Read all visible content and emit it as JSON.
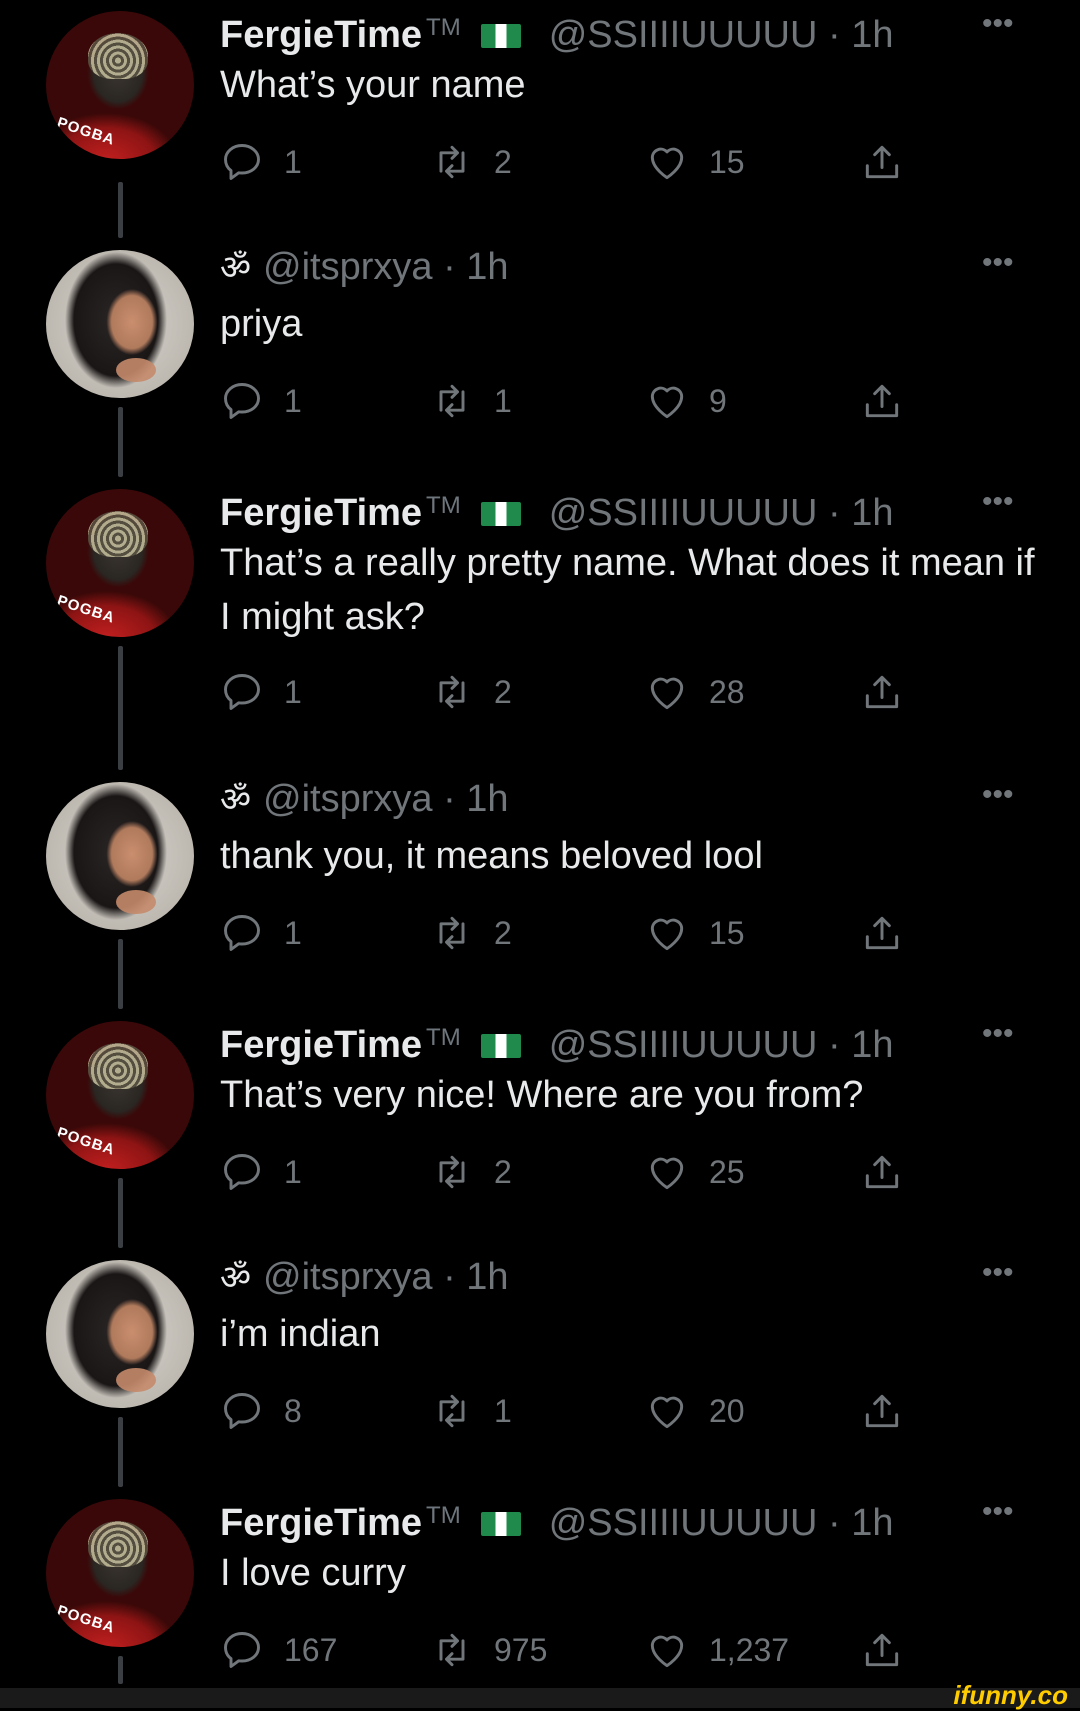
{
  "tweets": [
    {
      "author_type": "fergie",
      "name": "FergieTime",
      "tm": "TM",
      "handle": "@SSIIIIUUUUU",
      "time": "· 1h",
      "text": "What’s your name",
      "replies": "1",
      "retweets": "2",
      "likes": "15"
    },
    {
      "author_type": "priya",
      "om": "ॐ",
      "handle": "@itsprxya",
      "time": "· 1h",
      "text": "priya",
      "replies": "1",
      "retweets": "1",
      "likes": "9"
    },
    {
      "author_type": "fergie",
      "name": "FergieTime",
      "tm": "TM",
      "handle": "@SSIIIIUUUUU",
      "time": "· 1h",
      "text": "That’s a really pretty name. What does it mean if I might ask?",
      "replies": "1",
      "retweets": "2",
      "likes": "28"
    },
    {
      "author_type": "priya",
      "om": "ॐ",
      "handle": "@itsprxya",
      "time": "· 1h",
      "text": "thank you, it means beloved lool",
      "replies": "1",
      "retweets": "2",
      "likes": "15"
    },
    {
      "author_type": "fergie",
      "name": "FergieTime",
      "tm": "TM",
      "handle": "@SSIIIIUUUUU",
      "time": "· 1h",
      "text": "That’s very nice! Where are you from?",
      "replies": "1",
      "retweets": "2",
      "likes": "25"
    },
    {
      "author_type": "priya",
      "om": "ॐ",
      "handle": "@itsprxya",
      "time": "· 1h",
      "text": "i’m indian",
      "replies": "8",
      "retweets": "1",
      "likes": "20"
    },
    {
      "author_type": "fergie",
      "name": "FergieTime",
      "tm": "TM",
      "handle": "@SSIIIIUUUUU",
      "time": "· 1h",
      "text": "I love curry",
      "replies": "167",
      "retweets": "975",
      "likes": "1,237"
    }
  ],
  "more_glyph": "•••",
  "jersey_text": "POGBA",
  "watermark": "ifunny.co",
  "colors": {
    "background": "#000000",
    "text": "#e7e9ea",
    "secondary": "#71767b",
    "flag_green": "#1f8a4b",
    "watermark": "#ffcc00"
  }
}
